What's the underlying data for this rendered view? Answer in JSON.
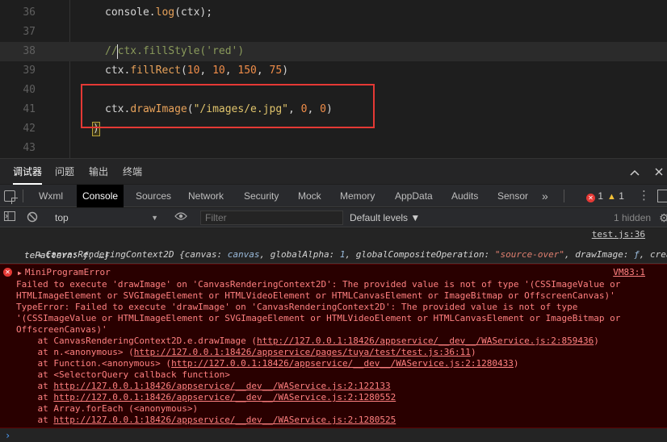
{
  "editor": {
    "lines": [
      {
        "num": "36",
        "tokens": [
          {
            "t": "console.",
            "c": "tok-plain"
          },
          {
            "t": "log",
            "c": "tok-fn"
          },
          {
            "t": "(ctx);",
            "c": "tok-plain"
          }
        ]
      },
      {
        "num": "37",
        "tokens": []
      },
      {
        "num": "38",
        "tokens": [
          {
            "t": "//ctx.fillStyle('red')",
            "c": "tok-cmt"
          }
        ]
      },
      {
        "num": "39",
        "tokens": [
          {
            "t": "ctx.",
            "c": "tok-plain"
          },
          {
            "t": "fillRect",
            "c": "tok-fn"
          },
          {
            "t": "(",
            "c": "tok-plain"
          },
          {
            "t": "10",
            "c": "tok-num"
          },
          {
            "t": ", ",
            "c": "tok-plain"
          },
          {
            "t": "10",
            "c": "tok-num"
          },
          {
            "t": ", ",
            "c": "tok-plain"
          },
          {
            "t": "150",
            "c": "tok-num"
          },
          {
            "t": ", ",
            "c": "tok-plain"
          },
          {
            "t": "75",
            "c": "tok-num"
          },
          {
            "t": ")",
            "c": "tok-plain"
          }
        ]
      },
      {
        "num": "40",
        "tokens": []
      },
      {
        "num": "41",
        "tokens": [
          {
            "t": "ctx.",
            "c": "tok-plain"
          },
          {
            "t": "drawImage",
            "c": "tok-fn"
          },
          {
            "t": "(",
            "c": "tok-plain"
          },
          {
            "t": "\"/images/e.jpg\"",
            "c": "tok-str"
          },
          {
            "t": ", ",
            "c": "tok-plain"
          },
          {
            "t": "0",
            "c": "tok-num"
          },
          {
            "t": ", ",
            "c": "tok-plain"
          },
          {
            "t": "0",
            "c": "tok-num"
          },
          {
            "t": ")",
            "c": "tok-plain"
          }
        ]
      },
      {
        "num": "42",
        "tokens": []
      },
      {
        "num": "43",
        "tokens": []
      }
    ],
    "line42_bracket": ")"
  },
  "panel_tabs": [
    "调试器",
    "问题",
    "输出",
    "终端"
  ],
  "devtools": {
    "tabs": [
      "Wxml",
      "Console",
      "Sources",
      "Network",
      "Security",
      "Mock",
      "Memory",
      "AppData",
      "Audits",
      "Sensor"
    ],
    "more": "»",
    "error_count": "1",
    "warning_count": "1",
    "kebab": "⋮"
  },
  "console_toolbar": {
    "context": "top",
    "filter_placeholder": "Filter",
    "levels": "Default levels ▼",
    "hidden": "1 hidden"
  },
  "log_entry": {
    "source": "test.js:36",
    "line1_parts": [
      {
        "t": "CanvasRenderingContext2D {",
        "c": "k-key"
      },
      {
        "t": "canvas: ",
        "c": "k-key"
      },
      {
        "t": "canvas",
        "c": "k-val"
      },
      {
        "t": ", globalAlpha: ",
        "c": "k-key"
      },
      {
        "t": "1",
        "c": "k-num"
      },
      {
        "t": ", globalCompositeOperation: ",
        "c": "k-key"
      },
      {
        "t": "\"source-over\"",
        "c": "k-str"
      },
      {
        "t": ", drawImage: ",
        "c": "k-key"
      },
      {
        "t": "ƒ",
        "c": "k-val"
      },
      {
        "t": ", crea",
        "c": "k-key"
      }
    ],
    "line2": "tePattern: ƒ, …}"
  },
  "error_entry": {
    "title": "MiniProgramError",
    "source": "VM83:1",
    "message_lines": [
      "Failed to execute 'drawImage' on 'CanvasRenderingContext2D': The provided value is not of type '(CSSImageValue or",
      "HTMLImageElement or SVGImageElement or HTMLVideoElement or HTMLCanvasElement or ImageBitmap or OffscreenCanvas)'",
      "TypeError: Failed to execute 'drawImage' on 'CanvasRenderingContext2D': The provided value is not of type",
      "'(CSSImageValue or HTMLImageElement or SVGImageElement or HTMLVideoElement or HTMLCanvasElement or ImageBitmap or",
      "OffscreenCanvas)'"
    ],
    "stack": [
      {
        "pre": "    at CanvasRenderingContext2D.e.drawImage (",
        "link": "http://127.0.0.1:18426/appservice/__dev__/WAService.js:2:859436",
        "post": ")"
      },
      {
        "pre": "    at n.<anonymous> (",
        "link": "http://127.0.0.1:18426/appservice/pages/tuya/test/test.js:36:11",
        "post": ")"
      },
      {
        "pre": "    at Function.<anonymous> (",
        "link": "http://127.0.0.1:18426/appservice/__dev__/WAService.js:2:1280433",
        "post": ")"
      },
      {
        "pre": "    at <SelectorQuery callback function>",
        "link": "",
        "post": ""
      },
      {
        "pre": "    at ",
        "link": "http://127.0.0.1:18426/appservice/__dev__/WAService.js:2:122133",
        "post": ""
      },
      {
        "pre": "    at ",
        "link": "http://127.0.0.1:18426/appservice/__dev__/WAService.js:2:1280552",
        "post": ""
      },
      {
        "pre": "    at Array.forEach (<anonymous>)",
        "link": "",
        "post": ""
      },
      {
        "pre": "    at ",
        "link": "http://127.0.0.1:18426/appservice/__dev__/WAService.js:2:1280525",
        "post": ""
      }
    ]
  },
  "prompt": "›"
}
